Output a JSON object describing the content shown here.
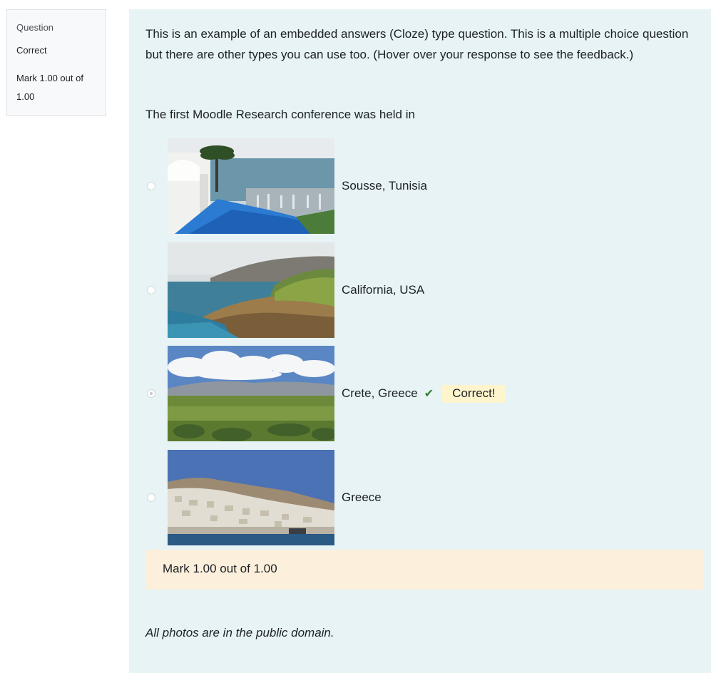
{
  "info": {
    "question_label": "Question",
    "state": "Correct",
    "grade": "Mark 1.00 out of 1.00"
  },
  "question": {
    "text": "This is an example of an embedded answers (Cloze) type question. This is a multiple choice question but there are other types you can use too. (Hover over your response to see the feedback.)",
    "prompt": "The first Moodle Research conference was held in",
    "options": [
      {
        "label": "Sousse, Tunisia",
        "selected": false
      },
      {
        "label": "California, USA",
        "selected": false
      },
      {
        "label": "Crete, Greece",
        "selected": true,
        "feedback": "Correct!",
        "icon": "check-icon"
      },
      {
        "label": "Greece",
        "selected": false
      }
    ]
  },
  "outcome": {
    "mark": "Mark 1.00 out of 1.00"
  },
  "footnote": "All photos are in the public domain.",
  "colors": {
    "content_bg": "#e7f3f5",
    "outcome_bg": "#fcefdc",
    "feedback_bg": "#fff5cc",
    "check": "#357a32"
  }
}
